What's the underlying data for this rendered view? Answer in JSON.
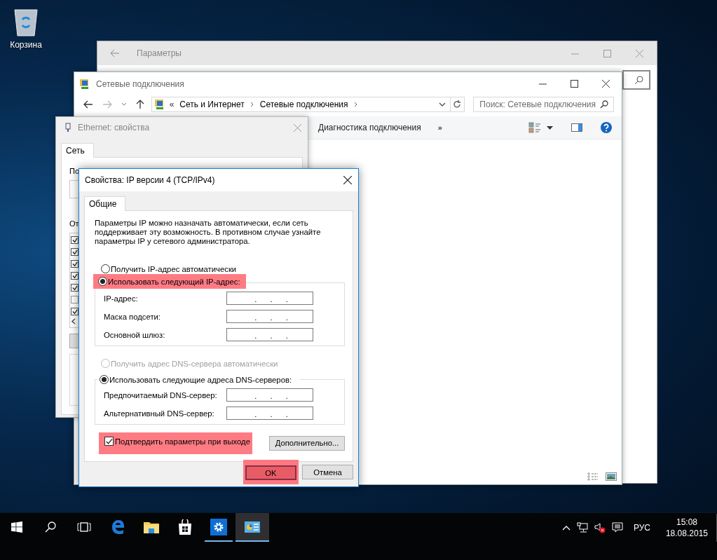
{
  "desktop": {
    "icons": [
      {
        "label": "Корзина"
      }
    ]
  },
  "settings_window": {
    "title": "Параметры"
  },
  "explorer_window": {
    "title": "Сетевые подключения",
    "breadcrumb_overflow": "«",
    "breadcrumb": [
      "Сеть и Интернет",
      "Сетевые подключения"
    ],
    "search": {
      "placeholder": "Поиск: Сетевые подключения"
    },
    "toolbar": [
      {
        "label": "Диагностика подключения"
      }
    ],
    "toolbar_overflow": "»"
  },
  "ethernet_window": {
    "title": "Ethernet: свойства",
    "tabs": [
      {
        "label": "Сеть",
        "selected": true
      }
    ],
    "label_1": "По",
    "label_2": "От",
    "components": [
      {
        "checked": true
      },
      {
        "checked": true
      },
      {
        "checked": true
      },
      {
        "checked": true
      },
      {
        "checked": true
      },
      {
        "checked": false
      },
      {
        "checked": true
      }
    ]
  },
  "ipv4_dialog": {
    "title": "Свойства: IP версии 4 (TCP/IPv4)",
    "tabs": [
      {
        "label": "Общие",
        "selected": true
      }
    ],
    "description": "Параметры IP можно назначать автоматически, если сеть поддерживает эту возможность. В противном случае узнайте параметры IP у сетевого администратора.",
    "ip_mode": [
      {
        "label": "Получить IP-адрес автоматически",
        "selected": false,
        "disabled": false,
        "highlighted": false
      },
      {
        "label": "Использовать следующий IP-адрес:",
        "selected": true,
        "disabled": false,
        "highlighted": true
      }
    ],
    "ip_fields": [
      {
        "label": "IP-адрес:",
        "dots": [
          ".",
          ".",
          "."
        ]
      },
      {
        "label": "Маска подсети:",
        "dots": [
          ".",
          ".",
          "."
        ]
      },
      {
        "label": "Основной шлюз:",
        "dots": [
          ".",
          ".",
          "."
        ]
      }
    ],
    "dns_mode": [
      {
        "label": "Получить адрес DNS-сервера автоматически",
        "selected": false,
        "disabled": true,
        "highlighted": false
      },
      {
        "label": "Использовать следующие адреса DNS-серверов:",
        "selected": true,
        "disabled": false,
        "highlighted": false
      }
    ],
    "dns_fields": [
      {
        "label": "Предпочитаемый DNS-сервер:",
        "dots": [
          ".",
          ".",
          "."
        ]
      },
      {
        "label": "Альтернативный DNS-сервер:",
        "dots": [
          ".",
          ".",
          "."
        ]
      }
    ],
    "validate": {
      "label": "Подтвердить параметры при выходе",
      "checked": true,
      "highlighted": true
    },
    "advanced_button": "Дополнительно...",
    "buttons": [
      {
        "label": "OK",
        "highlighted": true
      },
      {
        "label": "Отмена",
        "highlighted": false
      }
    ]
  },
  "taskbar": {
    "apps": [
      {
        "kind": "start"
      },
      {
        "kind": "search"
      },
      {
        "kind": "taskview"
      },
      {
        "kind": "edge",
        "running": false,
        "active": false
      },
      {
        "kind": "explorer",
        "running": false,
        "active": false
      },
      {
        "kind": "store",
        "running": false,
        "active": false
      },
      {
        "kind": "settings",
        "running": true,
        "active": false
      },
      {
        "kind": "control",
        "running": true,
        "active": true
      }
    ],
    "language": "РУС",
    "time": "15:08",
    "date": "18.08.2015"
  }
}
